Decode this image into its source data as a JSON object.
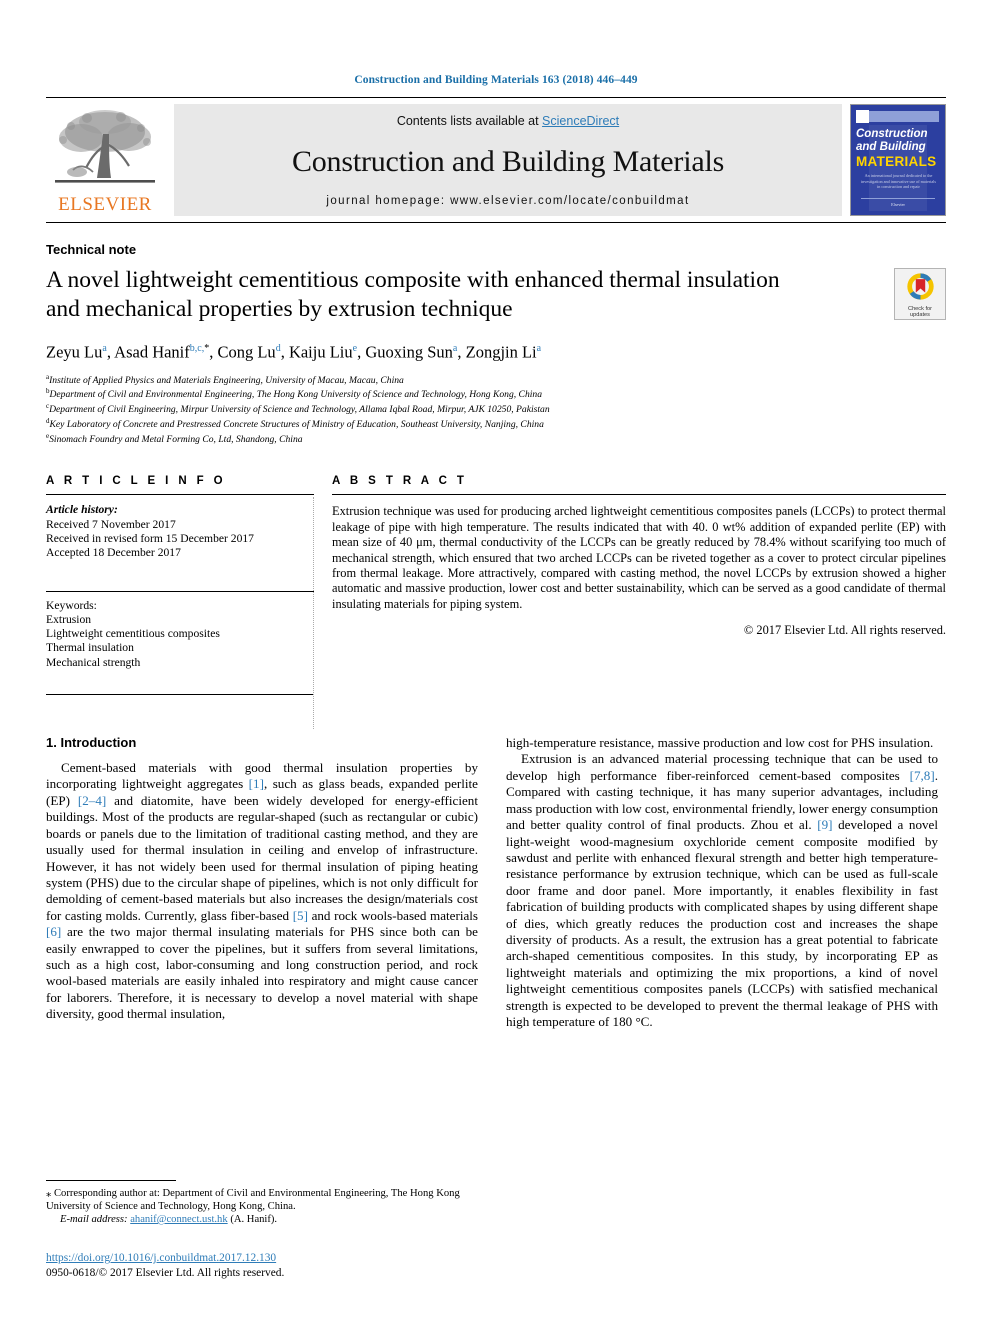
{
  "running_head": "Construction and Building Materials 163 (2018) 446–449",
  "masthead": {
    "publisher_name": "ELSEVIER",
    "contents_prefix": "Contents lists available at ",
    "contents_link": "ScienceDirect",
    "journal_name": "Construction and Building Materials",
    "homepage": "journal homepage: www.elsevier.com/locate/conbuildmat",
    "cover": {
      "line1": "Construction",
      "line2": "and Building",
      "line3": "MATERIALS",
      "blurb": "An international journal dedicated to the investigation and innovative use of materials in construction and repair",
      "footer": "Elsevier"
    },
    "link_color": "#2e7cb8"
  },
  "article": {
    "type": "Technical note",
    "title": "A novel lightweight cementitious composite with enhanced thermal insulation and mechanical properties by extrusion technique",
    "crossmark": {
      "line1": "Check for",
      "line2": "updates"
    },
    "authors": [
      {
        "name": "Zeyu Lu",
        "marks": "a",
        "sep": ", "
      },
      {
        "name": "Asad Hanif",
        "marks": "b,c,",
        "star": "*",
        "sep": ", "
      },
      {
        "name": "Cong Lu",
        "marks": "d",
        "sep": ", "
      },
      {
        "name": "Kaiju Liu",
        "marks": "e",
        "sep": ", "
      },
      {
        "name": "Guoxing Sun",
        "marks": "a",
        "sep": ", "
      },
      {
        "name": "Zongjin Li",
        "marks": "a",
        "sep": ""
      }
    ],
    "affiliations": [
      {
        "mark": "a",
        "text": "Institute of Applied Physics and Materials Engineering, University of Macau, Macau, China"
      },
      {
        "mark": "b",
        "text": "Department of Civil and Environmental Engineering, The Hong Kong University of Science and Technology, Hong Kong, China"
      },
      {
        "mark": "c",
        "text": "Department of Civil Engineering, Mirpur University of Science and Technology, Allama Iqbal Road, Mirpur, AJK 10250, Pakistan"
      },
      {
        "mark": "d",
        "text": "Key Laboratory of Concrete and Prestressed Concrete Structures of Ministry of Education, Southeast University, Nanjing, China"
      },
      {
        "mark": "e",
        "text": "Sinomach Foundry and Metal Forming Co, Ltd, Shandong, China"
      }
    ]
  },
  "article_info": {
    "heading": "A R T I C L E   I N F O",
    "history_label": "Article history:",
    "history": [
      "Received 7 November 2017",
      "Received in revised form 15 December 2017",
      "Accepted 18 December 2017"
    ],
    "keywords_label": "Keywords:",
    "keywords": [
      "Extrusion",
      "Lightweight cementitious composites",
      "Thermal insulation",
      "Mechanical strength"
    ]
  },
  "abstract": {
    "heading": "A B S T R A C T",
    "text": "Extrusion technique was used for producing arched lightweight cementitious composites panels (LCCPs) to protect thermal leakage of pipe with high temperature. The results indicated that with 40. 0 wt% addition of expanded perlite (EP) with mean size of 40 μm, thermal conductivity of the LCCPs can be greatly reduced by 78.4% without scarifying too much of mechanical strength, which ensured that two arched LCCPs can be riveted together as a cover to protect circular pipelines from thermal leakage. More attractively, compared with casting method, the novel LCCPs by extrusion showed a higher automatic and massive production, lower cost and better sustainability, which can be served as a good candidate of thermal insulating materials for piping system.",
    "copyright": "© 2017 Elsevier Ltd. All rights reserved."
  },
  "body": {
    "section_heading": "1. Introduction",
    "left_paragraph_1": "Cement-based materials with good thermal insulation properties by incorporating lightweight aggregates [1], such as glass beads, expanded perlite (EP) [2–4] and diatomite, have been widely developed for energy-efficient buildings. Most of the products are regular-shaped (such as rectangular or cubic) boards or panels due to the limitation of traditional casting method, and they are usually used for thermal insulation in ceiling and envelop of infrastructure. However, it has not widely been used for thermal insulation of piping heating system (PHS) due to the circular shape of pipelines, which is not only difficult for demolding of cement-based materials but also increases the design/materials cost for casting molds. Currently, glass fiber-based [5] and rock wools-based materials [6] are the two major thermal insulating materials for PHS since both can be easily enwrapped to cover the pipelines, but it suffers from several limitations, such as a high cost, labor-consuming and long construction period, and rock wool-based materials are easily inhaled into respiratory and might cause cancer for laborers. Therefore, it is necessary to develop a novel material with shape diversity, good thermal insulation,",
    "right_paragraph_1": "high-temperature resistance, massive production and low cost for PHS insulation.",
    "right_paragraph_2": "Extrusion is an advanced material processing technique that can be used to develop high performance fiber-reinforced cement-based composites [7,8]. Compared with casting technique, it has many superior advantages, including mass production with low cost, environmental friendly, lower energy consumption and better quality control of final products. Zhou et al. [9] developed a novel light-weight wood-magnesium oxychloride cement composite modified by sawdust and perlite with enhanced flexural strength and better high temperature-resistance performance by extrusion technique, which can be used as full-scale door frame and door panel. More importantly, it enables flexibility in fast fabrication of building products with complicated shapes by using different shape of dies, which greatly reduces the production cost and increases the shape diversity of products. As a result, the extrusion has a great potential to fabricate arch-shaped cementitious composites. In this study, by incorporating EP as lightweight materials and optimizing the mix proportions, a kind of novel lightweight cementitious composites panels (LCCPs) with satisfied mechanical strength is expected to be developed to prevent the thermal leakage of PHS with high temperature of 180 °C."
  },
  "footer": {
    "corresponding_marker": "⁎",
    "corresponding": "Corresponding author at: Department of Civil and Environmental Engineering, The Hong Kong University of Science and Technology, Hong Kong, China.",
    "email_label": "E-mail address:",
    "email": "ahanif@connect.ust.hk",
    "email_attribution": "(A. Hanif).",
    "doi": "https://doi.org/10.1016/j.conbuildmat.2017.12.130",
    "issn_line": "0950-0618/© 2017 Elsevier Ltd. All rights reserved."
  }
}
